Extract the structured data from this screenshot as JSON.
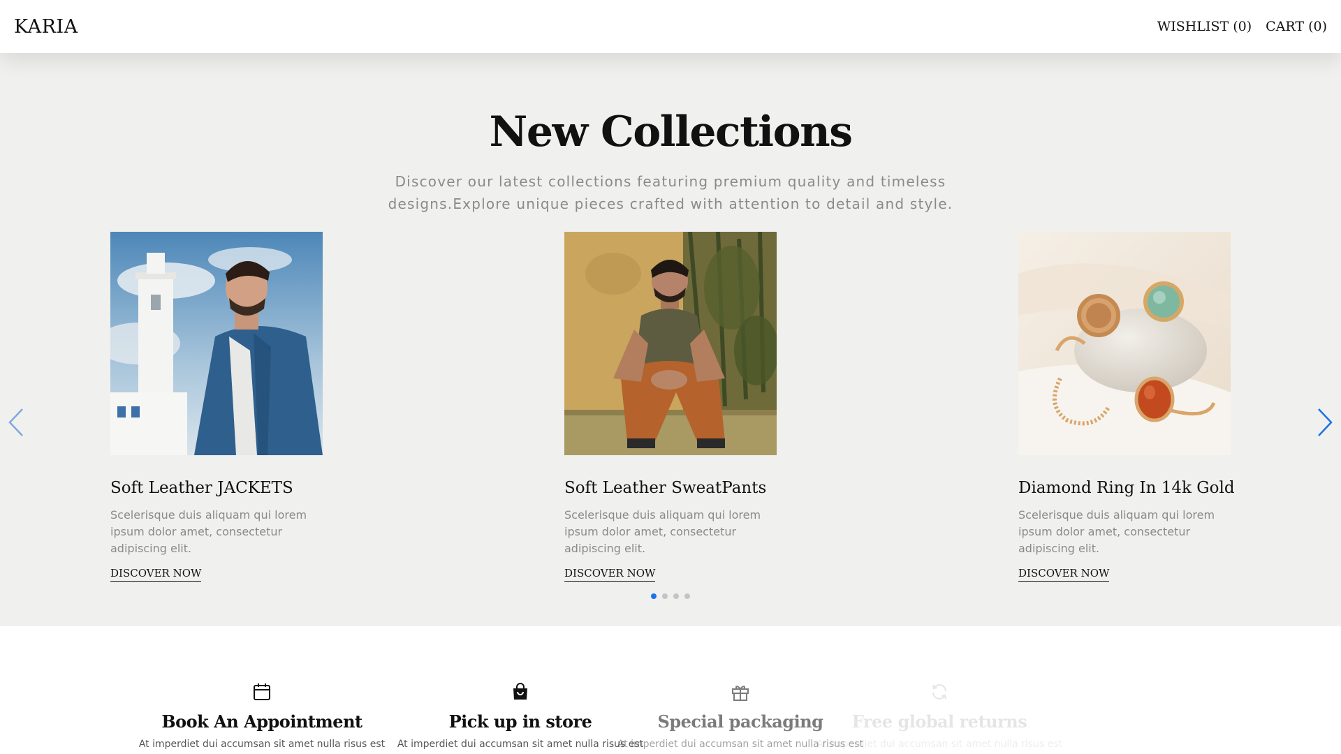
{
  "header": {
    "logo": "KARIA",
    "wishlist_label": "WISHLIST (0)",
    "cart_label": "CART (0)"
  },
  "collections": {
    "title": "New Collections",
    "description": "Discover our latest collections featuring premium quality and timeless designs.Explore unique pieces crafted with attention to detail and style.",
    "cards": [
      {
        "title": "Soft Leather JACKETS",
        "description": "Scelerisque duis aliquam qui lorem ipsum dolor amet, consectetur adipiscing elit.",
        "link": "DISCOVER NOW"
      },
      {
        "title": "Soft Leather SweatPants",
        "description": "Scelerisque duis aliquam qui lorem ipsum dolor amet, consectetur adipiscing elit.",
        "link": "DISCOVER NOW"
      },
      {
        "title": "Diamond Ring In 14k Gold",
        "description": "Scelerisque duis aliquam qui lorem ipsum dolor amet, consectetur adipiscing elit.",
        "link": "DISCOVER NOW"
      }
    ],
    "carousel": {
      "pages": 4,
      "active_page": 1
    },
    "arrow_icons": [
      "chevron-left-icon",
      "chevron-right-icon"
    ],
    "accent_color": "#1a73e8"
  },
  "features": [
    {
      "icon": "calendar-icon",
      "title": "Book An Appointment",
      "description": "At imperdiet dui accumsan sit amet nulla risus est"
    },
    {
      "icon": "shopping-bag-icon",
      "title": "Pick up in store",
      "description": "At imperdiet dui accumsan sit amet nulla risus est"
    },
    {
      "icon": "gift-icon",
      "title": "Special packaging",
      "description": "At imperdiet dui accumsan sit amet nulla risus est"
    },
    {
      "icon": "refresh-icon",
      "title": "Free global returns",
      "description": "At imperdiet dui accumsan sit amet nulla risus est"
    }
  ]
}
